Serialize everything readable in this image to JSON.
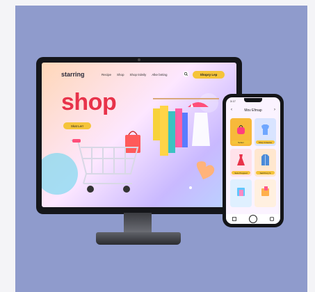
{
  "site": {
    "logo": "starring",
    "nav_links": [
      "Recipe",
      "Shop",
      "Shop trdeily",
      "Alke bnting"
    ],
    "cta": "Shopry Lep",
    "hero_title": "shop",
    "hero_button": "Skat Lerr"
  },
  "phone": {
    "status_time": "3:17",
    "title": "Mov Efmap",
    "cards": [
      {
        "label": "Seben",
        "bg": "#f7b93a",
        "icon": "handbag-icon"
      },
      {
        "label": "Shop Indeetse",
        "bg": "#d9e4ff",
        "icon": "shirt-icon"
      },
      {
        "label": "Sele Prepped",
        "bg": "#ffe2ea",
        "icon": "dress-icon"
      },
      {
        "label": "Sail Prery S",
        "bg": "#ffe7cf",
        "icon": "jacket-icon"
      },
      {
        "label": "",
        "bg": "#dff0ff",
        "icon": "shopping-bag-icon"
      },
      {
        "label": "",
        "bg": "#fff0e0",
        "icon": "gift-bag-icon"
      }
    ]
  },
  "colors": {
    "accent": "#e8334a",
    "button": "#f5c43a",
    "backdrop": "#8f9bcc"
  }
}
